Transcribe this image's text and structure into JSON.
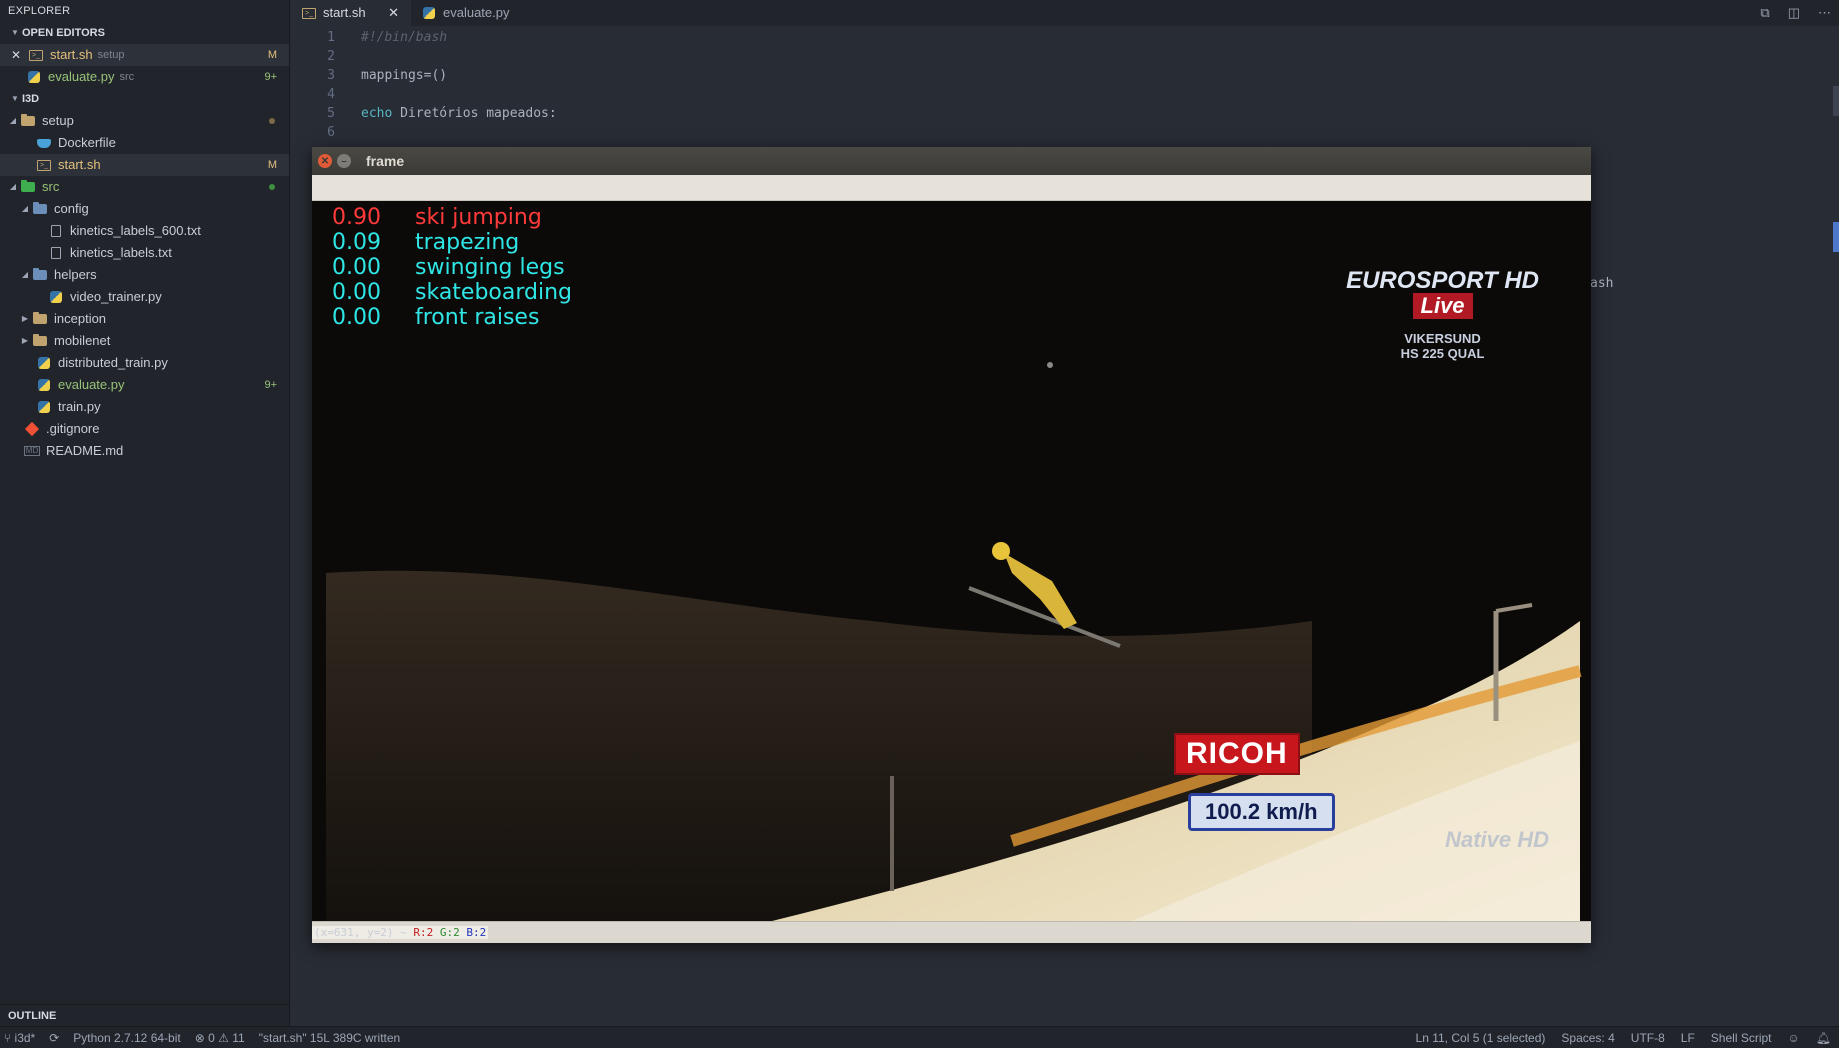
{
  "sidebar": {
    "title": "EXPLORER",
    "open_editors_header": "OPEN EDITORS",
    "open_editors": [
      {
        "name": "start.sh",
        "hint": "setup",
        "badge": "M"
      },
      {
        "name": "evaluate.py",
        "hint": "src",
        "badge": "9+"
      }
    ],
    "project_header": "I3D",
    "tree": {
      "setup": "setup",
      "dockerfile": "Dockerfile",
      "start_sh": "start.sh",
      "start_sh_badge": "M",
      "src": "src",
      "config": "config",
      "kinetics600": "kinetics_labels_600.txt",
      "kinetics": "kinetics_labels.txt",
      "helpers": "helpers",
      "video_trainer": "video_trainer.py",
      "inception": "inception",
      "mobilenet": "mobilenet",
      "distributed_train": "distributed_train.py",
      "evaluate": "evaluate.py",
      "evaluate_badge": "9+",
      "train": "train.py",
      "gitignore": ".gitignore",
      "readme": "README.md"
    },
    "outline_header": "OUTLINE"
  },
  "tabs": [
    {
      "label": "start.sh",
      "close": "✕"
    },
    {
      "label": "evaluate.py"
    }
  ],
  "editor": {
    "lines": [
      {
        "n": "1",
        "text": "#!/bin/bash"
      },
      {
        "n": "2",
        "text": ""
      },
      {
        "n": "3",
        "text": "mappings=()"
      },
      {
        "n": "4",
        "text": ""
      },
      {
        "n": "5",
        "kw": "echo",
        "text": " Diretórios mapeados:"
      },
      {
        "n": "6",
        "text": ""
      }
    ],
    "stray_text": "ash"
  },
  "frame": {
    "title": "frame",
    "predictions": [
      {
        "p": "0.90",
        "label": "ski jumping"
      },
      {
        "p": "0.09",
        "label": "trapezing"
      },
      {
        "p": "0.00",
        "label": "swinging legs"
      },
      {
        "p": "0.00",
        "label": "skateboarding"
      },
      {
        "p": "0.00",
        "label": "front raises"
      }
    ],
    "logo_top": "EUROSPORT HD",
    "logo_live": "Live",
    "logo_sub1": "VIKERSUND",
    "logo_sub2": "HS 225 QUAL",
    "ricoh": "RICOH",
    "speed": "100.2 km/h",
    "native": "Native HD",
    "status_coords": "(x=631, y=2) ~",
    "status_r": "R:2",
    "status_g": "G:2",
    "status_b": "B:2"
  },
  "statusbar": {
    "project": "i3d*",
    "python": "Python 2.7.12 64-bit",
    "errors": "0",
    "warnings": "11",
    "message": "\"start.sh\" 15L 389C written",
    "cursor": "Ln 11, Col 5 (1 selected)",
    "spaces": "Spaces: 4",
    "encoding": "UTF-8",
    "eol": "LF",
    "language": "Shell Script"
  },
  "colors": {
    "sidebar_bg": "#21252b",
    "editor_bg": "#282c34",
    "prediction_top": "#ff3a3a",
    "prediction_rest": "#2fe6e6"
  }
}
